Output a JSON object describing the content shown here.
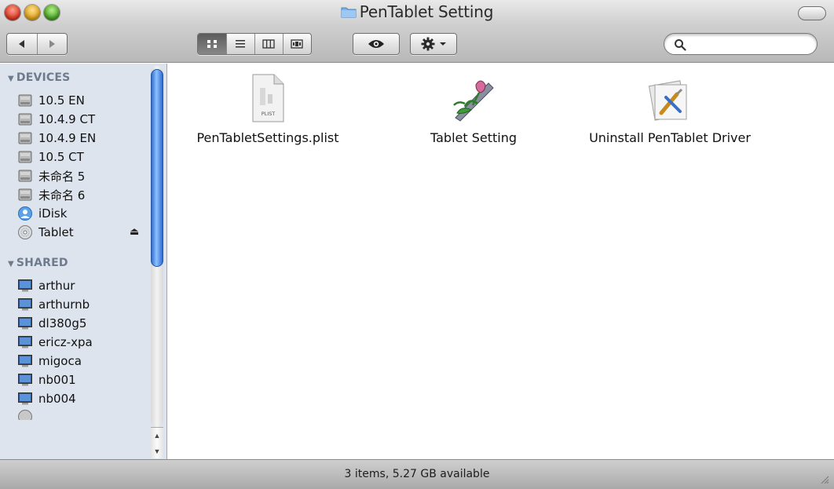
{
  "window": {
    "title": "PenTablet Setting",
    "title_icon": "folder-icon"
  },
  "toolbar": {
    "back_icon": "back-arrow-icon",
    "forward_icon": "forward-arrow-icon",
    "view_modes": [
      "icon-view-icon",
      "list-view-icon",
      "column-view-icon",
      "coverflow-view-icon"
    ],
    "active_view": "icon-view-icon",
    "quicklook_icon": "eye-icon",
    "action_icon": "gear-icon",
    "search": {
      "value": "",
      "placeholder": ""
    }
  },
  "sidebar": {
    "devices_header": "DEVICES",
    "devices": [
      {
        "label": "10.5 EN",
        "icon": "hard-disk-icon"
      },
      {
        "label": "10.4.9 CT",
        "icon": "hard-disk-icon"
      },
      {
        "label": "10.4.9 EN",
        "icon": "hard-disk-icon"
      },
      {
        "label": "10.5 CT",
        "icon": "hard-disk-icon"
      },
      {
        "label": "未命名 5",
        "icon": "hard-disk-icon"
      },
      {
        "label": "未命名 6",
        "icon": "hard-disk-icon"
      },
      {
        "label": "iDisk",
        "icon": "idisk-icon"
      },
      {
        "label": "Tablet",
        "icon": "cd-icon"
      }
    ],
    "eject_symbol": "⏏",
    "shared_header": "SHARED",
    "shared": [
      {
        "label": "arthur",
        "icon": "computer-icon"
      },
      {
        "label": "arthurnb",
        "icon": "computer-icon"
      },
      {
        "label": "dl380g5",
        "icon": "computer-icon"
      },
      {
        "label": "ericz-xpa",
        "icon": "computer-icon"
      },
      {
        "label": "migoca",
        "icon": "computer-icon"
      },
      {
        "label": "nb001",
        "icon": "computer-icon"
      },
      {
        "label": "nb004",
        "icon": "computer-icon"
      }
    ]
  },
  "files": [
    {
      "name": "PenTabletSettings.plist",
      "icon": "plist-file-icon",
      "badge": "PLIST"
    },
    {
      "name": "Tablet Setting",
      "icon": "tablet-setting-app-icon"
    },
    {
      "name": "Uninstall PenTablet Driver",
      "icon": "uninstaller-app-icon"
    }
  ],
  "status": {
    "text": "3 items, 5.27 GB available"
  },
  "colors": {
    "sidebar_bg": "#dde4ee",
    "section_header": "#6e7b8c",
    "scroll_thumb": "#3b7ddb"
  }
}
